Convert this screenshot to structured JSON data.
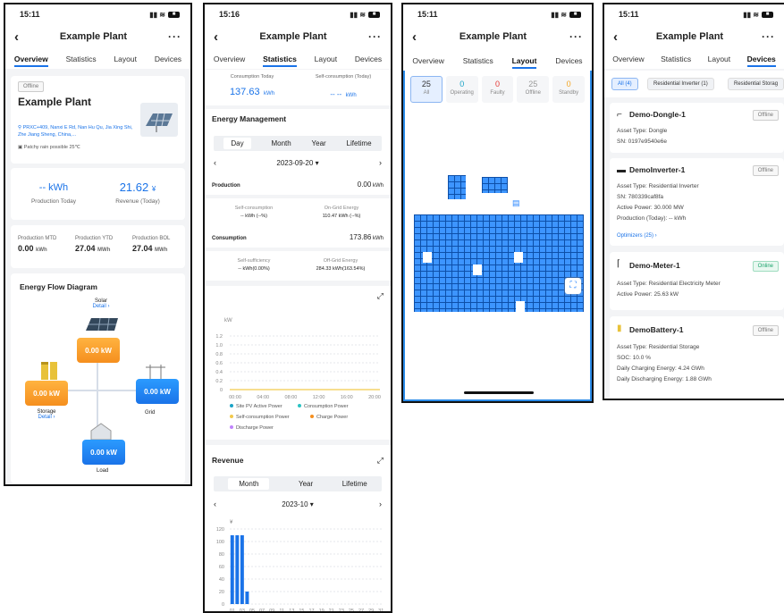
{
  "p1": {
    "time": "15:11",
    "title": "Example Plant",
    "tabs": [
      "Overview",
      "Statistics",
      "Layout",
      "Devices"
    ],
    "status": "Offline",
    "plant_name": "Example Plant",
    "address": "PRXC+409, Nanxi E Rd, Nan Hu Qu, Jia Xing Shi, Zhe Jiang Sheng, China,...",
    "weather": "Patchy rain possible 25℃",
    "prod_today_val": "-- kWh",
    "prod_today_label": "Production Today",
    "revenue_val": "21.62",
    "revenue_unit": "¥",
    "revenue_label": "Revenue (Today)",
    "mtd_label": "Production MTD",
    "mtd_val": "0.00",
    "mtd_unit": "kWh",
    "ytd_label": "Production YTD",
    "ytd_val": "27.04",
    "ytd_unit": "MWh",
    "bol_label": "Production BOL",
    "bol_val": "27.04",
    "bol_unit": "MWh",
    "flow_title": "Energy Flow Diagram",
    "solar_label": "Solar",
    "solar_detail": "Detail ›",
    "solar_val": "0.00 kW",
    "storage_label": "Storage",
    "storage_detail": "Detail ›",
    "storage_val": "0.00 kW",
    "grid_label": "Grid",
    "grid_val": "0.00 kW",
    "load_label": "Load",
    "load_val": "0.00 kW"
  },
  "p2": {
    "time": "15:16",
    "title": "Example Plant",
    "tabs": [
      "Overview",
      "Statistics",
      "Layout",
      "Devices"
    ],
    "cons_today_label": "Consumption Today",
    "cons_today_val": "137.63",
    "cons_today_unit": "kWh",
    "selfcons_label": "Self-consumption (Today)",
    "selfcons_val": "-- --",
    "selfcons_unit": "kWh",
    "em_title": "Energy Management",
    "periods": [
      "Day",
      "Month",
      "Year",
      "Lifetime"
    ],
    "date": "2023-09-20",
    "production_label": "Production",
    "production_val": "0.00",
    "production_unit": "kWh",
    "self_cons_label": "Self-consumption",
    "self_cons_val": "-- kWh (--%)",
    "ongrid_label": "On-Grid Energy",
    "ongrid_val": "110.47 kWh (--%)",
    "consumption_label": "Consumption",
    "consumption_val": "173.86",
    "consumption_unit": "kWh",
    "self_suff_label": "Self-sufficiency",
    "self_suff_val": "-- kWh(0.00%)",
    "offgrid_label": "Off-Grid Energy",
    "offgrid_val": "284.33 kWh(163.54%)",
    "chart_unit": "kW",
    "yticks": [
      "1.2",
      "1.0",
      "0.8",
      "0.6",
      "0.4",
      "0.2",
      "0"
    ],
    "xticks": [
      "00:00",
      "04:00",
      "08:00",
      "12:00",
      "16:00",
      "20:00"
    ],
    "legend": [
      "Site PV Active Power",
      "Consumption Power",
      "Self-consumption Power",
      "Charge Power",
      "Discharge Power"
    ],
    "rev_title": "Revenue",
    "rev_periods": [
      "Month",
      "Year",
      "Lifetime"
    ],
    "rev_date": "2023-10",
    "rev_unit": "¥",
    "rev_yticks": [
      "120",
      "100",
      "80",
      "60",
      "40",
      "20",
      "0"
    ],
    "rev_xticks": [
      "01",
      "03",
      "05",
      "07",
      "09",
      "11",
      "13",
      "15",
      "17",
      "19",
      "21",
      "23",
      "25",
      "27",
      "29",
      "31"
    ]
  },
  "chart_data": {
    "type": "bar",
    "title": "Revenue",
    "ylabel": "¥",
    "ylim": [
      0,
      120
    ],
    "categories": [
      "01",
      "02",
      "03",
      "04"
    ],
    "values": [
      110,
      110,
      110,
      20
    ]
  },
  "p3": {
    "time": "15:11",
    "title": "Example Plant",
    "tabs": [
      "Overview",
      "Statistics",
      "Layout",
      "Devices"
    ],
    "counts": [
      {
        "n": "25",
        "label": "All",
        "color": "#333"
      },
      {
        "n": "0",
        "label": "Operating",
        "color": "#1aa3c6"
      },
      {
        "n": "0",
        "label": "Faulty",
        "color": "#e53935"
      },
      {
        "n": "25",
        "label": "Offline",
        "color": "#999"
      },
      {
        "n": "0",
        "label": "Standby",
        "color": "#f5a623"
      }
    ]
  },
  "p4": {
    "time": "15:11",
    "title": "Example Plant",
    "tabs": [
      "Overview",
      "Statistics",
      "Layout",
      "Devices"
    ],
    "filters": [
      "All (4)",
      "Residential Inverter (1)",
      "Residential Storag"
    ],
    "d1": {
      "name": "Demo-Dongle-1",
      "status": "Offline",
      "l1": "Asset Type:  Dongle",
      "l2": "SN:  0197e9540e6e"
    },
    "d2": {
      "name": "DemoInverter-1",
      "status": "Offline",
      "l1": "Asset Type:  Residential Inverter",
      "l2": "SN:  780339caf8fa",
      "l3": "Active Power:  30.000 MW",
      "l4": "Production (Today):  -- kWh",
      "link": "Optimizers (25) ›"
    },
    "d3": {
      "name": "Demo-Meter-1",
      "status": "Online",
      "l1": "Asset Type:  Residential Electricity Meter",
      "l2": "Active Power:  25.63 kW"
    },
    "d4": {
      "name": "DemoBattery-1",
      "status": "Offline",
      "l1": "Asset Type:  Residential Storage",
      "l2": "SOC:  10.0 %",
      "l3": "Daily Charging Energy:  4.24 GWh",
      "l4": "Daily Discharging Energy:  1.88 GWh"
    }
  }
}
